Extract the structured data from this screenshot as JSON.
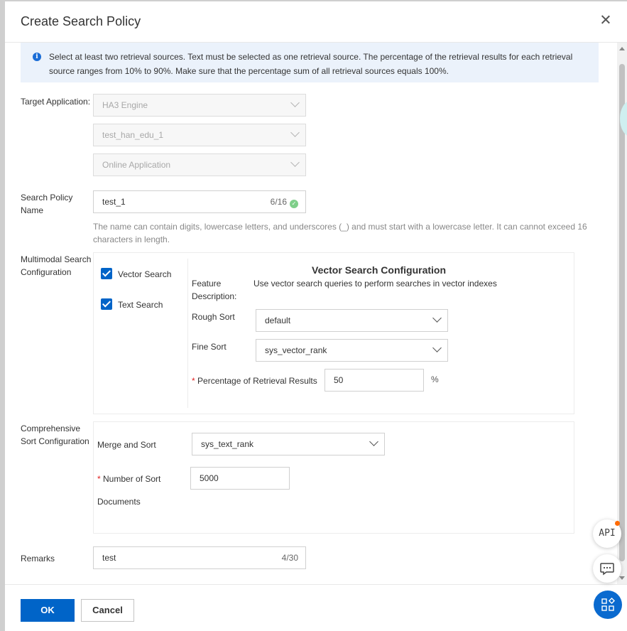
{
  "dialog": {
    "title": "Create Search Policy"
  },
  "notice": {
    "text": "Select at least two retrieval sources. Text must be selected as one retrieval source. The percentage of the retrieval results for each retrieval source ranges from 10% to 90%. Make sure that the percentage sum of all retrieval sources equals 100%."
  },
  "target_application": {
    "label": "Target Application:",
    "engine": "HA3 Engine",
    "instance": "test_han_edu_1",
    "app_type": "Online Application"
  },
  "policy_name": {
    "label": "Search Policy Name",
    "value": "test_1",
    "count": "6/16",
    "help": "The name can contain digits, lowercase letters, and underscores (_) and must start with a lowercase letter. It can cannot exceed 16 characters in length."
  },
  "multimodal": {
    "label": "Multimodal Search Configuration",
    "vector_label": "Vector Search",
    "text_label": "Text Search",
    "vector_checked": true,
    "text_checked": true,
    "config_title": "Vector Search Configuration",
    "feature_label": "Feature Description:",
    "feature_value": "Use vector search queries to perform searches in vector indexes",
    "rough_label": "Rough Sort",
    "rough_value": "default",
    "fine_label": "Fine Sort",
    "fine_value": "sys_vector_rank",
    "pct_label": "Percentage of Retrieval Results",
    "pct_value": "50",
    "pct_unit": "%"
  },
  "comprehensive": {
    "label": "Comprehensive Sort Configuration",
    "merge_label": "Merge and Sort",
    "merge_value": "sys_text_rank",
    "num_label": "Number of Sort",
    "num_label2": "Documents",
    "num_value": "5000"
  },
  "remarks": {
    "label": "Remarks",
    "value": "test",
    "count": "4/30"
  },
  "footer": {
    "ok": "OK",
    "cancel": "Cancel"
  },
  "floating": {
    "api": "API"
  },
  "colors": {
    "primary": "#0064c8",
    "notice_bg": "#ebf2fb",
    "required": "#e02020"
  }
}
